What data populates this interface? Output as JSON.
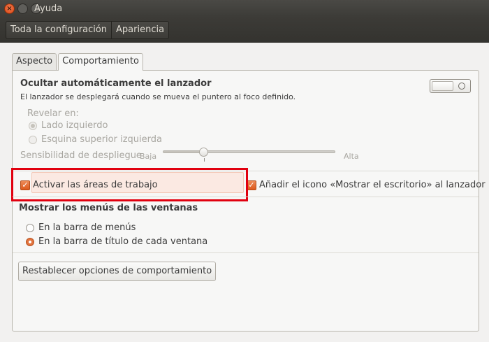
{
  "window": {
    "title": "Ayuda"
  },
  "toolbar": {
    "breadcrumb": [
      "Toda la configuración",
      "Apariencia"
    ]
  },
  "tabs": [
    {
      "label": "Aspecto",
      "active": false
    },
    {
      "label": "Comportamiento",
      "active": true
    }
  ],
  "autohide": {
    "title": "Ocultar automáticamente el lanzador",
    "description": "El lanzador se desplegará cuando se mueva el puntero al foco definido.",
    "enabled": false,
    "reveal_label": "Revelar en:",
    "reveal_options": [
      "Lado izquierdo",
      "Esquina superior izquierda"
    ],
    "reveal_selected": "Lado izquierdo",
    "sensitivity_label": "Sensibilidad de despliegue",
    "sensitivity_low": "Baja",
    "sensitivity_high": "Alta",
    "sensitivity_level": 0.24
  },
  "workspaces": {
    "label": "Activar las áreas de trabajo",
    "checked": true
  },
  "desktop_icon": {
    "label": "Añadir el icono «Mostrar el escritorio» al lanzador",
    "checked": true
  },
  "menus": {
    "title": "Mostrar los menús de las ventanas",
    "options": [
      "En la barra de menús",
      "En la barra de título de cada ventana"
    ],
    "selected": "En la barra de título de cada ventana"
  },
  "reset_button": "Restablecer opciones de comportamiento",
  "colors": {
    "accent": "#e2733d",
    "highlight_border": "#e1000f",
    "titlebar": "#3c3b37"
  }
}
